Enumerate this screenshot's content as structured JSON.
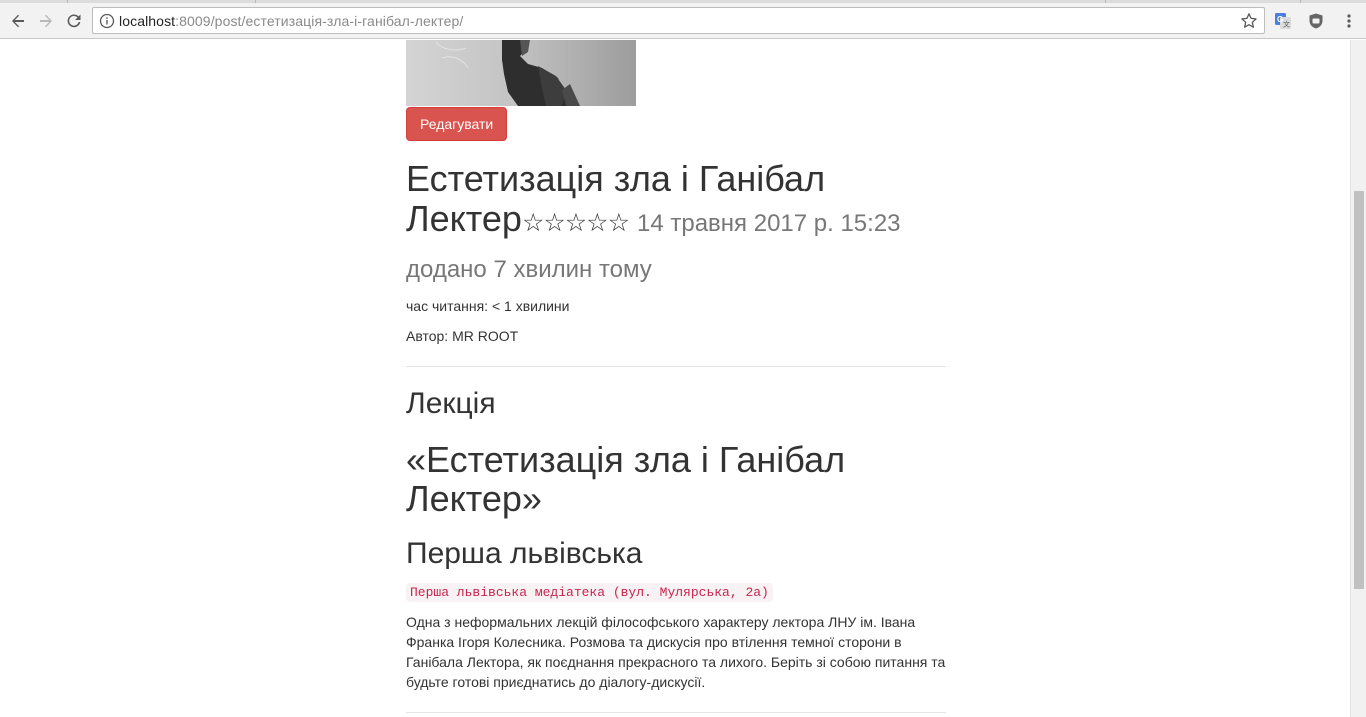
{
  "browser": {
    "address_host": "localhost",
    "address_rest": ":8009/post/естетизація-зла-і-ганібал-лектер/"
  },
  "post": {
    "edit_label": "Редагувати",
    "title_line1": "Естетизація зла і Ганібал",
    "title_line2": "Лектер",
    "stars": "☆☆☆☆☆",
    "rating": 0,
    "date": "14 травня 2017 р. 15:23",
    "added": "додано 7 хвилин тому",
    "read_time": "час читання: < 1 хвилини",
    "author": "Автор: MR ROOT"
  },
  "body": {
    "heading_lecture": "Лекція",
    "heading_quote_line1": "«Естетизація зла і Ганібал",
    "heading_quote_line2": "Лектер»",
    "heading_place": "Перша львівська",
    "location_code": "Перша львівська медіатека (вул. Мулярська, 2а)",
    "description": "Одна з неформальних лекцій філософського характеру лектора ЛНУ ім. Івана Франка Ігоря Колесника. Розмова та дискусія про втілення темної сторони в Ганібала Лектора, як поєднання прекрасного та лихого. Беріть зі собою питання та будьте готові приєднатись до діалогу-дискусії."
  },
  "colors": {
    "danger": "#d9534f",
    "code_text": "#c7254e",
    "code_bg": "#f9f2f4",
    "muted": "#777777"
  },
  "icons": [
    "back-arrow-icon",
    "forward-arrow-icon",
    "reload-icon",
    "info-icon",
    "bookmark-star-icon",
    "translate-extension-icon",
    "shield-extension-icon",
    "kebab-menu-icon"
  ]
}
